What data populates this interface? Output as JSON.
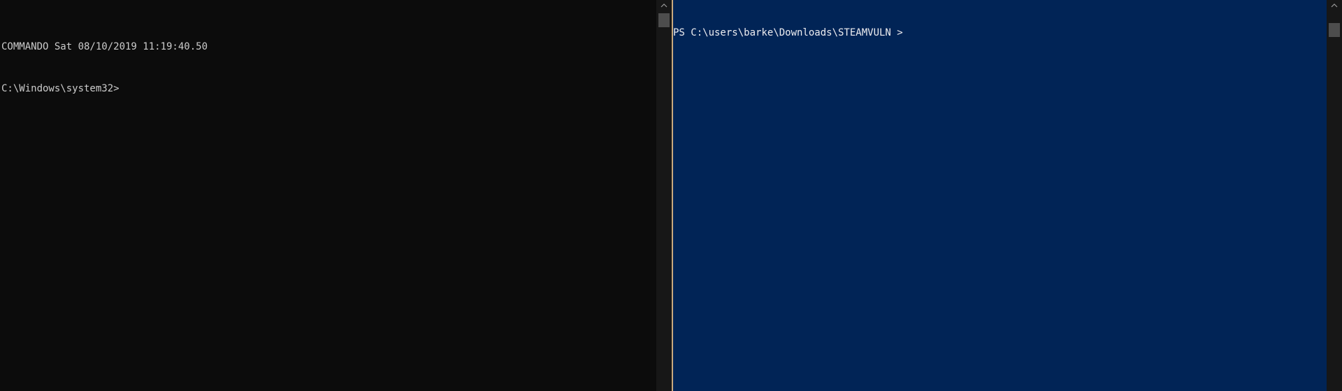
{
  "cmd_pane": {
    "lines": [
      "COMMANDO Sat 08/10/2019 11:19:40.50",
      "C:\\Windows\\system32>"
    ],
    "background": "#0c0c0c",
    "foreground": "#cccccc"
  },
  "ps_pane": {
    "lines": [
      "PS C:\\users\\barke\\Downloads\\STEAMVULN >"
    ],
    "background": "#012456",
    "foreground": "#eeedf0"
  },
  "icons": {
    "scroll_up": "chevron-up-icon"
  },
  "accent": {
    "pane_divider": "#c8a97e"
  }
}
